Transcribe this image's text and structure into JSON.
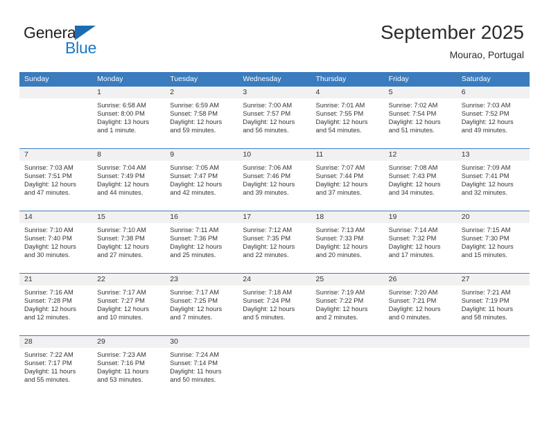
{
  "brand": {
    "name_part1": "General",
    "name_part2": "Blue",
    "color_primary": "#1878c8",
    "color_triangle": "#1c6cb3"
  },
  "header": {
    "title": "September 2025",
    "location": "Mourao, Portugal"
  },
  "calendar": {
    "header_bg": "#3a7cbe",
    "daynum_bg": "#f1f1f1",
    "weekdays": [
      "Sunday",
      "Monday",
      "Tuesday",
      "Wednesday",
      "Thursday",
      "Friday",
      "Saturday"
    ],
    "weeks": [
      [
        {
          "day": "",
          "lines": []
        },
        {
          "day": "1",
          "lines": [
            "Sunrise: 6:58 AM",
            "Sunset: 8:00 PM",
            "Daylight: 13 hours",
            "and 1 minute."
          ]
        },
        {
          "day": "2",
          "lines": [
            "Sunrise: 6:59 AM",
            "Sunset: 7:58 PM",
            "Daylight: 12 hours",
            "and 59 minutes."
          ]
        },
        {
          "day": "3",
          "lines": [
            "Sunrise: 7:00 AM",
            "Sunset: 7:57 PM",
            "Daylight: 12 hours",
            "and 56 minutes."
          ]
        },
        {
          "day": "4",
          "lines": [
            "Sunrise: 7:01 AM",
            "Sunset: 7:55 PM",
            "Daylight: 12 hours",
            "and 54 minutes."
          ]
        },
        {
          "day": "5",
          "lines": [
            "Sunrise: 7:02 AM",
            "Sunset: 7:54 PM",
            "Daylight: 12 hours",
            "and 51 minutes."
          ]
        },
        {
          "day": "6",
          "lines": [
            "Sunrise: 7:03 AM",
            "Sunset: 7:52 PM",
            "Daylight: 12 hours",
            "and 49 minutes."
          ]
        }
      ],
      [
        {
          "day": "7",
          "lines": [
            "Sunrise: 7:03 AM",
            "Sunset: 7:51 PM",
            "Daylight: 12 hours",
            "and 47 minutes."
          ]
        },
        {
          "day": "8",
          "lines": [
            "Sunrise: 7:04 AM",
            "Sunset: 7:49 PM",
            "Daylight: 12 hours",
            "and 44 minutes."
          ]
        },
        {
          "day": "9",
          "lines": [
            "Sunrise: 7:05 AM",
            "Sunset: 7:47 PM",
            "Daylight: 12 hours",
            "and 42 minutes."
          ]
        },
        {
          "day": "10",
          "lines": [
            "Sunrise: 7:06 AM",
            "Sunset: 7:46 PM",
            "Daylight: 12 hours",
            "and 39 minutes."
          ]
        },
        {
          "day": "11",
          "lines": [
            "Sunrise: 7:07 AM",
            "Sunset: 7:44 PM",
            "Daylight: 12 hours",
            "and 37 minutes."
          ]
        },
        {
          "day": "12",
          "lines": [
            "Sunrise: 7:08 AM",
            "Sunset: 7:43 PM",
            "Daylight: 12 hours",
            "and 34 minutes."
          ]
        },
        {
          "day": "13",
          "lines": [
            "Sunrise: 7:09 AM",
            "Sunset: 7:41 PM",
            "Daylight: 12 hours",
            "and 32 minutes."
          ]
        }
      ],
      [
        {
          "day": "14",
          "lines": [
            "Sunrise: 7:10 AM",
            "Sunset: 7:40 PM",
            "Daylight: 12 hours",
            "and 30 minutes."
          ]
        },
        {
          "day": "15",
          "lines": [
            "Sunrise: 7:10 AM",
            "Sunset: 7:38 PM",
            "Daylight: 12 hours",
            "and 27 minutes."
          ]
        },
        {
          "day": "16",
          "lines": [
            "Sunrise: 7:11 AM",
            "Sunset: 7:36 PM",
            "Daylight: 12 hours",
            "and 25 minutes."
          ]
        },
        {
          "day": "17",
          "lines": [
            "Sunrise: 7:12 AM",
            "Sunset: 7:35 PM",
            "Daylight: 12 hours",
            "and 22 minutes."
          ]
        },
        {
          "day": "18",
          "lines": [
            "Sunrise: 7:13 AM",
            "Sunset: 7:33 PM",
            "Daylight: 12 hours",
            "and 20 minutes."
          ]
        },
        {
          "day": "19",
          "lines": [
            "Sunrise: 7:14 AM",
            "Sunset: 7:32 PM",
            "Daylight: 12 hours",
            "and 17 minutes."
          ]
        },
        {
          "day": "20",
          "lines": [
            "Sunrise: 7:15 AM",
            "Sunset: 7:30 PM",
            "Daylight: 12 hours",
            "and 15 minutes."
          ]
        }
      ],
      [
        {
          "day": "21",
          "lines": [
            "Sunrise: 7:16 AM",
            "Sunset: 7:28 PM",
            "Daylight: 12 hours",
            "and 12 minutes."
          ]
        },
        {
          "day": "22",
          "lines": [
            "Sunrise: 7:17 AM",
            "Sunset: 7:27 PM",
            "Daylight: 12 hours",
            "and 10 minutes."
          ]
        },
        {
          "day": "23",
          "lines": [
            "Sunrise: 7:17 AM",
            "Sunset: 7:25 PM",
            "Daylight: 12 hours",
            "and 7 minutes."
          ]
        },
        {
          "day": "24",
          "lines": [
            "Sunrise: 7:18 AM",
            "Sunset: 7:24 PM",
            "Daylight: 12 hours",
            "and 5 minutes."
          ]
        },
        {
          "day": "25",
          "lines": [
            "Sunrise: 7:19 AM",
            "Sunset: 7:22 PM",
            "Daylight: 12 hours",
            "and 2 minutes."
          ]
        },
        {
          "day": "26",
          "lines": [
            "Sunrise: 7:20 AM",
            "Sunset: 7:21 PM",
            "Daylight: 12 hours",
            "and 0 minutes."
          ]
        },
        {
          "day": "27",
          "lines": [
            "Sunrise: 7:21 AM",
            "Sunset: 7:19 PM",
            "Daylight: 11 hours",
            "and 58 minutes."
          ]
        }
      ],
      [
        {
          "day": "28",
          "lines": [
            "Sunrise: 7:22 AM",
            "Sunset: 7:17 PM",
            "Daylight: 11 hours",
            "and 55 minutes."
          ]
        },
        {
          "day": "29",
          "lines": [
            "Sunrise: 7:23 AM",
            "Sunset: 7:16 PM",
            "Daylight: 11 hours",
            "and 53 minutes."
          ]
        },
        {
          "day": "30",
          "lines": [
            "Sunrise: 7:24 AM",
            "Sunset: 7:14 PM",
            "Daylight: 11 hours",
            "and 50 minutes."
          ]
        },
        {
          "day": "",
          "lines": []
        },
        {
          "day": "",
          "lines": []
        },
        {
          "day": "",
          "lines": []
        },
        {
          "day": "",
          "lines": []
        }
      ]
    ]
  }
}
